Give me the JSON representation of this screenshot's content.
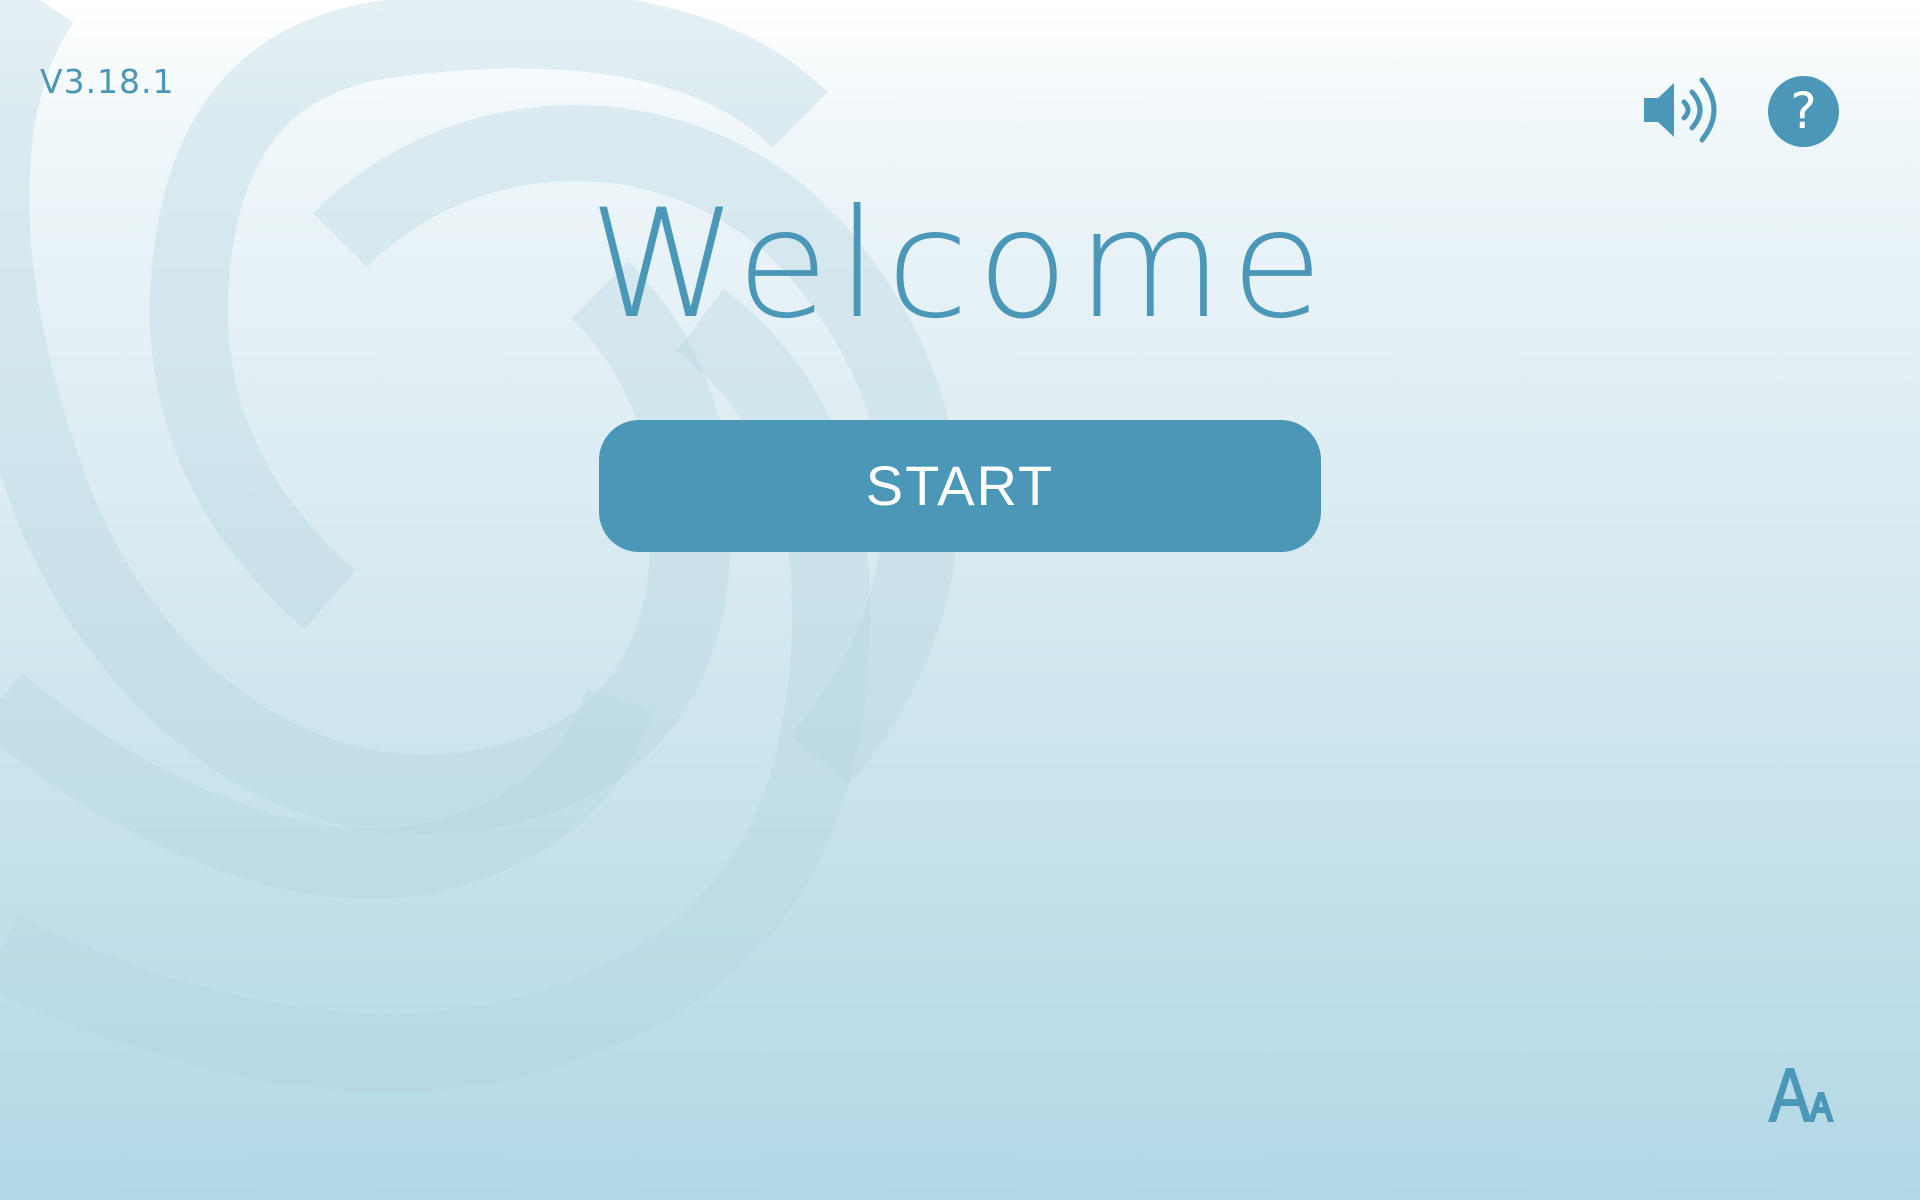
{
  "app": {
    "version": "V3.18.1",
    "title": "Welcome",
    "start_label": "START",
    "help_label": "?"
  },
  "icons": {
    "sound": "speaker-volume-icon",
    "help": "question-mark-icon",
    "font_size": "font-size-icon"
  },
  "colors": {
    "accent": "#4a97b7",
    "button_text": "#ffffff",
    "background_top": "#ffffff",
    "background_bottom": "#b2d8e6"
  }
}
